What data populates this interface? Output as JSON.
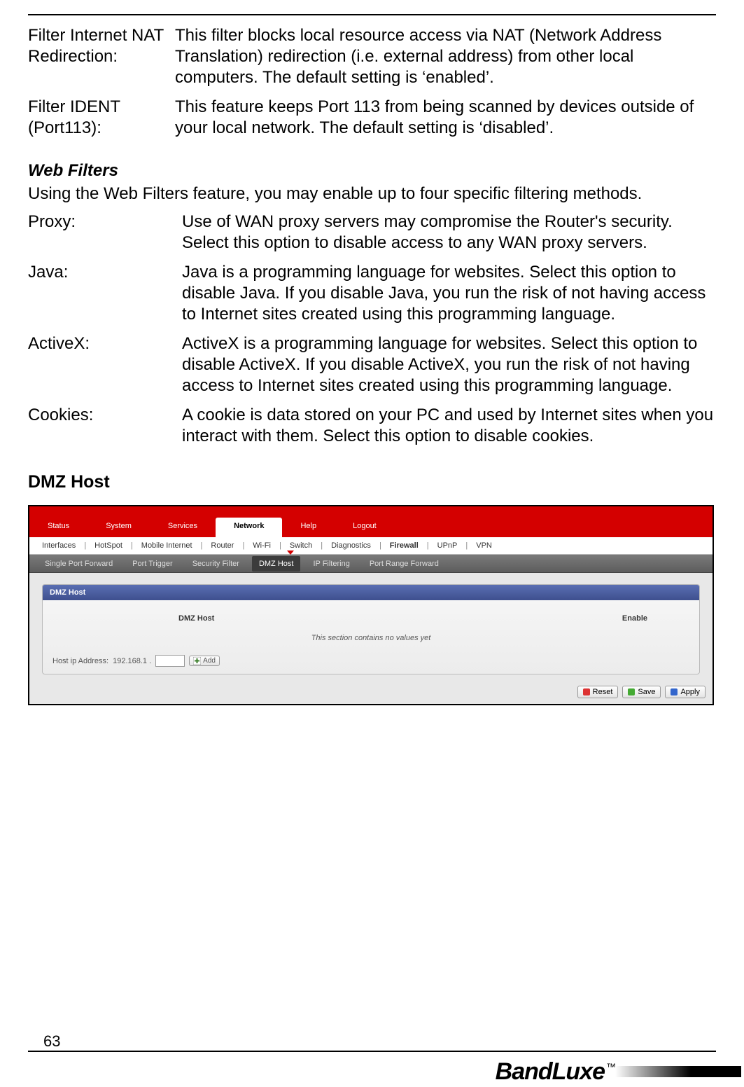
{
  "top_defs": [
    {
      "label": "Filter Internet NAT Redirection:",
      "desc": "This filter blocks local resource access via NAT (Network Address Translation) redirection (i.e. external address) from other local computers. The default setting is ‘enabled’."
    },
    {
      "label": "Filter IDENT (Port113):",
      "desc": "This feature keeps Port 113 from being scanned by devices outside of your local network. The default setting is ‘disabled’."
    }
  ],
  "web_filters": {
    "title": "Web Filters",
    "intro": "Using the Web Filters feature, you may enable up to four specific filtering methods.",
    "items": [
      {
        "label": "Proxy:",
        "desc": "Use of WAN proxy servers may compromise the Router's security. Select this option to disable access to any WAN proxy servers."
      },
      {
        "label": "Java:",
        "desc": "Java is a programming language for websites. Select this option to disable Java. If you disable Java, you run the risk of not having access to Internet sites created using this programming language."
      },
      {
        "label": "ActiveX:",
        "desc": "ActiveX is a programming language for websites. Select this option to disable ActiveX. If you disable ActiveX, you run the risk of not having access to Internet sites created using this programming language."
      },
      {
        "label": "Cookies:",
        "desc": "A cookie is data stored on your PC and used by Internet sites when you interact with them. Select this option to disable cookies."
      }
    ]
  },
  "dmz_heading": "DMZ Host",
  "router_ui": {
    "main_tabs": [
      "Status",
      "System",
      "Services",
      "Network",
      "Help",
      "Logout"
    ],
    "main_active": "Network",
    "sub_tabs": [
      "Interfaces",
      "HotSpot",
      "Mobile Internet",
      "Router",
      "Wi-Fi",
      "Switch",
      "Diagnostics",
      "Firewall",
      "UPnP",
      "VPN"
    ],
    "sub_active": "Firewall",
    "tert_tabs": [
      "Single Port Forward",
      "Port Trigger",
      "Security Filter",
      "DMZ Host",
      "IP Filtering",
      "Port Range Forward"
    ],
    "tert_active": "DMZ Host",
    "panel_title": "DMZ Host",
    "col1": "DMZ Host",
    "col2": "Enable",
    "no_values": "This section contains no values yet",
    "host_label": "Host ip Address:",
    "host_prefix": "192.168.1 .",
    "add_btn": "Add",
    "footer_buttons": {
      "reset": "Reset",
      "save": "Save",
      "apply": "Apply"
    }
  },
  "page_number": "63",
  "brand": "BandLuxe",
  "tm": "™"
}
